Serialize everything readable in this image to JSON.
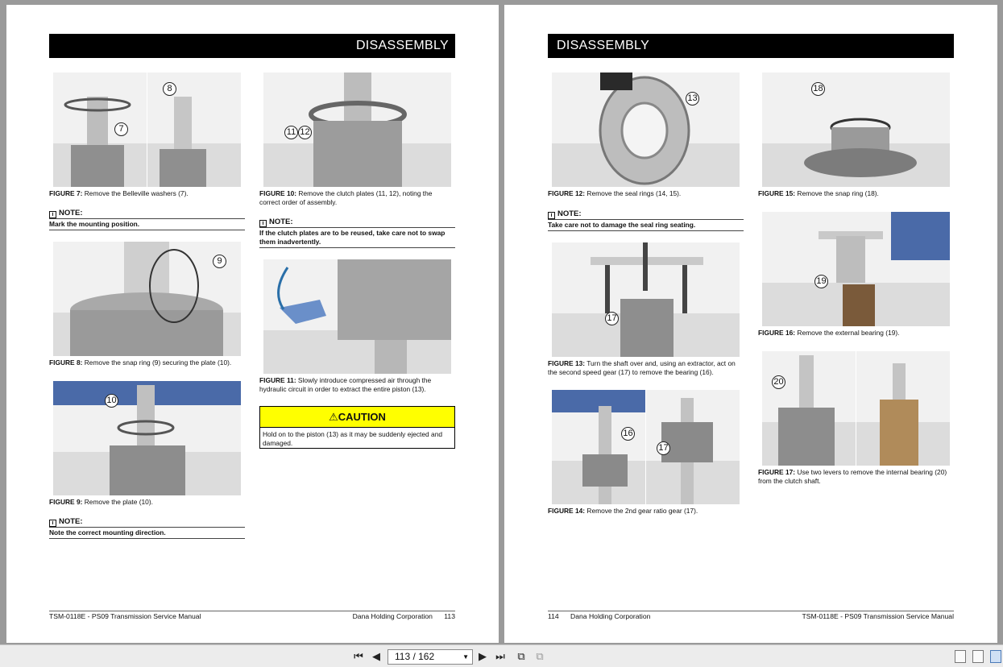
{
  "left_page": {
    "header": "DISASSEMBLY",
    "fig7": {
      "label": "FIGURE 7:",
      "text": " Remove the Belleville washers (7).",
      "callouts": [
        "8",
        "7"
      ]
    },
    "note1": {
      "head": "NOTE:",
      "body": "Mark the mounting position."
    },
    "fig8": {
      "label": "FIGURE 8:",
      "text": " Remove the snap ring (9) securing the plate (10).",
      "callouts": [
        "9"
      ]
    },
    "fig9": {
      "label": "FIGURE 9:",
      "text": " Remove the plate (10).",
      "callouts": [
        "10"
      ]
    },
    "note2": {
      "head": "NOTE:",
      "body": "Note the correct mounting direction."
    },
    "fig10": {
      "label": "FIGURE 10:",
      "text": " Remove the clutch plates (11, 12), noting the correct order of assembly.",
      "callouts": [
        "11",
        "12"
      ]
    },
    "note3": {
      "head": "NOTE:",
      "body": "If the clutch plates are to be reused, take care not to swap them inadvertently."
    },
    "fig11": {
      "label": "FIGURE 11:",
      "text": " Slowly introduce compressed air through the hydraulic circuit in order to extract the entire piston (13)."
    },
    "caution": {
      "head": "⚠CAUTION",
      "body": "Hold on to the piston (13) as it may be suddenly ejected and damaged."
    },
    "footer": {
      "left": "TSM-0118E - PS09 Transmission Service Manual",
      "right": "Dana Holding Corporation      113"
    }
  },
  "right_page": {
    "header": "DISASSEMBLY",
    "fig12": {
      "label": "FIGURE 12:",
      "text": " Remove the seal rings (14, 15).",
      "callouts": [
        "13"
      ]
    },
    "note1": {
      "head": "NOTE:",
      "body": "Take care not to damage the seal ring seating."
    },
    "fig13": {
      "label": "FIGURE 13:",
      "text": " Turn the shaft over and, using an extractor, act on the second speed gear (17) to remove the bearing (16).",
      "callouts": [
        "17"
      ]
    },
    "fig14": {
      "label": "FIGURE 14:",
      "text": " Remove the 2nd gear ratio gear (17).",
      "callouts": [
        "16",
        "17"
      ]
    },
    "fig15": {
      "label": "FIGURE 15:",
      "text": " Remove the snap ring (18).",
      "callouts": [
        "18"
      ]
    },
    "fig16": {
      "label": "FIGURE 16:",
      "text": " Remove the external bearing (19).",
      "callouts": [
        "19"
      ]
    },
    "fig17": {
      "label": "FIGURE 17:",
      "text": " Use two levers to remove the internal bearing (20) from the clutch shaft.",
      "callouts": [
        "20"
      ]
    },
    "footer": {
      "left": "114      Dana Holding Corporation",
      "right": "TSM-0118E - PS09 Transmission Service Manual"
    }
  },
  "toolbar": {
    "page_indicator": "113 / 162",
    "icons": [
      "first-page-icon",
      "prev-page-icon",
      "next-page-icon",
      "last-page-icon",
      "rotate-icon",
      "copy-icon",
      "single-page-view-icon",
      "continuous-view-icon",
      "two-page-view-icon"
    ]
  },
  "colors": {
    "header_bg": "#000000",
    "caution_bg": "#ffff00",
    "backdrop": "#9a9a9a"
  }
}
